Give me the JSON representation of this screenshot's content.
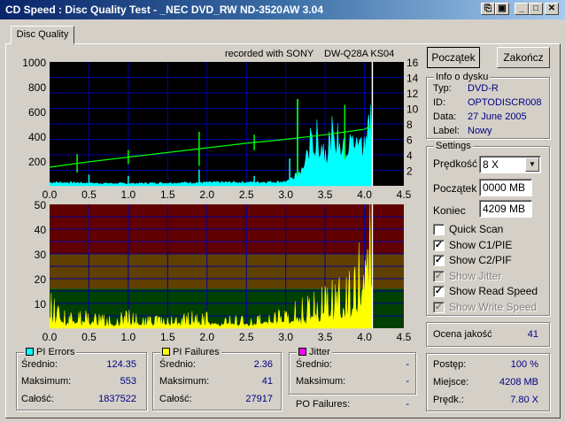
{
  "window": {
    "title": "CD Speed : Disc Quality Test - _NEC    DVD_RW ND-3520AW 3.04",
    "controls": [
      "minimize-icon",
      "maximize-icon",
      "close-icon"
    ]
  },
  "tabs": [
    {
      "label": "Disc Quality"
    }
  ],
  "chart_header": {
    "recorded_with": "recorded with SONY",
    "media": "DW-Q28A KS04"
  },
  "chart_data": [
    {
      "type": "area",
      "name": "pi-errors-chart",
      "xlabel": "",
      "ylabel": "",
      "xlim": [
        0,
        4.5
      ],
      "ylim": [
        0,
        1000
      ],
      "y2lim": [
        0,
        16
      ],
      "x_ticks": [
        "0.0",
        "0.5",
        "1.0",
        "1.5",
        "2.0",
        "2.5",
        "3.0",
        "3.5",
        "4.0",
        "4.5"
      ],
      "y_ticks": [
        "1000",
        "800",
        "600",
        "400",
        "200"
      ],
      "y2_ticks": [
        "16",
        "14",
        "12",
        "10",
        "8",
        "6",
        "4",
        "2"
      ],
      "grid": true,
      "background": "#000000",
      "series": [
        {
          "name": "PI Errors",
          "color": "#00ffff",
          "x": [
            0.0,
            0.3,
            0.6,
            1.0,
            1.4,
            1.8,
            2.2,
            2.6,
            2.9,
            3.05,
            3.1,
            3.15,
            3.2,
            3.3,
            3.4,
            3.5,
            3.6,
            3.7,
            3.8,
            3.9,
            4.0,
            4.05,
            4.1
          ],
          "y": [
            30,
            28,
            22,
            20,
            25,
            28,
            30,
            32,
            35,
            40,
            90,
            110,
            120,
            380,
            420,
            350,
            440,
            430,
            400,
            430,
            460,
            540,
            553
          ]
        },
        {
          "name": "Read Speed",
          "color": "#00ff00",
          "axis": "right",
          "x": [
            0.0,
            0.5,
            1.0,
            1.5,
            2.0,
            2.5,
            3.0,
            3.5,
            4.0,
            4.1
          ],
          "y": [
            2.4,
            3.1,
            3.7,
            4.3,
            4.9,
            5.5,
            6.0,
            6.6,
            7.3,
            7.8
          ]
        }
      ],
      "markers": [
        4.1
      ]
    },
    {
      "type": "bar",
      "name": "pi-failures-chart",
      "xlabel": "",
      "ylabel": "",
      "xlim": [
        0,
        4.5
      ],
      "ylim": [
        0,
        50
      ],
      "x_ticks": [
        "0.0",
        "0.5",
        "1.0",
        "1.5",
        "2.0",
        "2.5",
        "3.0",
        "3.5",
        "4.0",
        "4.5"
      ],
      "y_ticks": [
        "50",
        "40",
        "30",
        "20",
        "10"
      ],
      "grid": true,
      "bands": [
        {
          "from": 0,
          "to": 16,
          "color": "#004000"
        },
        {
          "from": 16,
          "to": 30,
          "color": "#604000"
        },
        {
          "from": 30,
          "to": 50,
          "color": "#600000"
        }
      ],
      "series": [
        {
          "name": "PI Failures",
          "color": "#ffff00",
          "x": [
            0.0,
            0.2,
            0.5,
            0.8,
            1.0,
            1.3,
            1.6,
            1.9,
            2.2,
            2.5,
            2.8,
            3.0,
            3.2,
            3.4,
            3.6,
            3.8,
            3.9,
            4.0,
            4.05,
            4.1
          ],
          "y": [
            6,
            3,
            3,
            2,
            3,
            2,
            2,
            3,
            2,
            2,
            3,
            3,
            5,
            6,
            8,
            9,
            12,
            25,
            38,
            41
          ]
        }
      ],
      "markers": [
        4.1
      ]
    }
  ],
  "stats": {
    "pi_errors": {
      "title": "PI Errors",
      "color": "#00ffff",
      "avg_label": "Średnio:",
      "avg": "124.35",
      "max_label": "Maksimum:",
      "max": "553",
      "total_label": "Całość:",
      "total": "1837522"
    },
    "pi_failures": {
      "title": "PI Failures",
      "color": "#ffff00",
      "avg_label": "Średnio:",
      "avg": "2.36",
      "max_label": "Maksimum:",
      "max": "41",
      "total_label": "Całość:",
      "total": "27917"
    },
    "jitter": {
      "title": "Jitter",
      "color": "#ff00ff",
      "avg_label": "Średnio:",
      "avg": "-",
      "max_label": "Maksimum:",
      "max": "-"
    },
    "po_failures": {
      "label": "PO Failures:",
      "value": "-"
    }
  },
  "buttons": {
    "start": "Początek",
    "exit": "Zakończ"
  },
  "disc_info": {
    "title": "Info o dysku",
    "type_label": "Typ:",
    "type": "DVD-R",
    "id_label": "ID:",
    "id": "OPTODISCR008",
    "date_label": "Data:",
    "date": "27 June 2005",
    "label_label": "Label:",
    "label": "Nowy"
  },
  "settings": {
    "title": "Settings",
    "speed_label": "Prędkość",
    "speed": "8 X",
    "start_label": "Początek",
    "start": "0000 MB",
    "end_label": "Koniec",
    "end": "4209 MB",
    "checks": [
      {
        "label": "Quick Scan",
        "checked": false,
        "disabled": false
      },
      {
        "label": "Show C1/PIE",
        "checked": true,
        "disabled": false
      },
      {
        "label": "Show C2/PIF",
        "checked": true,
        "disabled": false
      },
      {
        "label": "Show Jitter",
        "checked": true,
        "disabled": true
      },
      {
        "label": "Show Read Speed",
        "checked": true,
        "disabled": false
      },
      {
        "label": "Show Write Speed",
        "checked": true,
        "disabled": true
      }
    ]
  },
  "quality": {
    "label": "Ocena jakość",
    "value": "41"
  },
  "progress": {
    "progress_label": "Postęp:",
    "progress": "100 %",
    "position_label": "Miejsce:",
    "position": "4208 MB",
    "speed_label": "Prędk.:",
    "speed": "7.80 X"
  }
}
